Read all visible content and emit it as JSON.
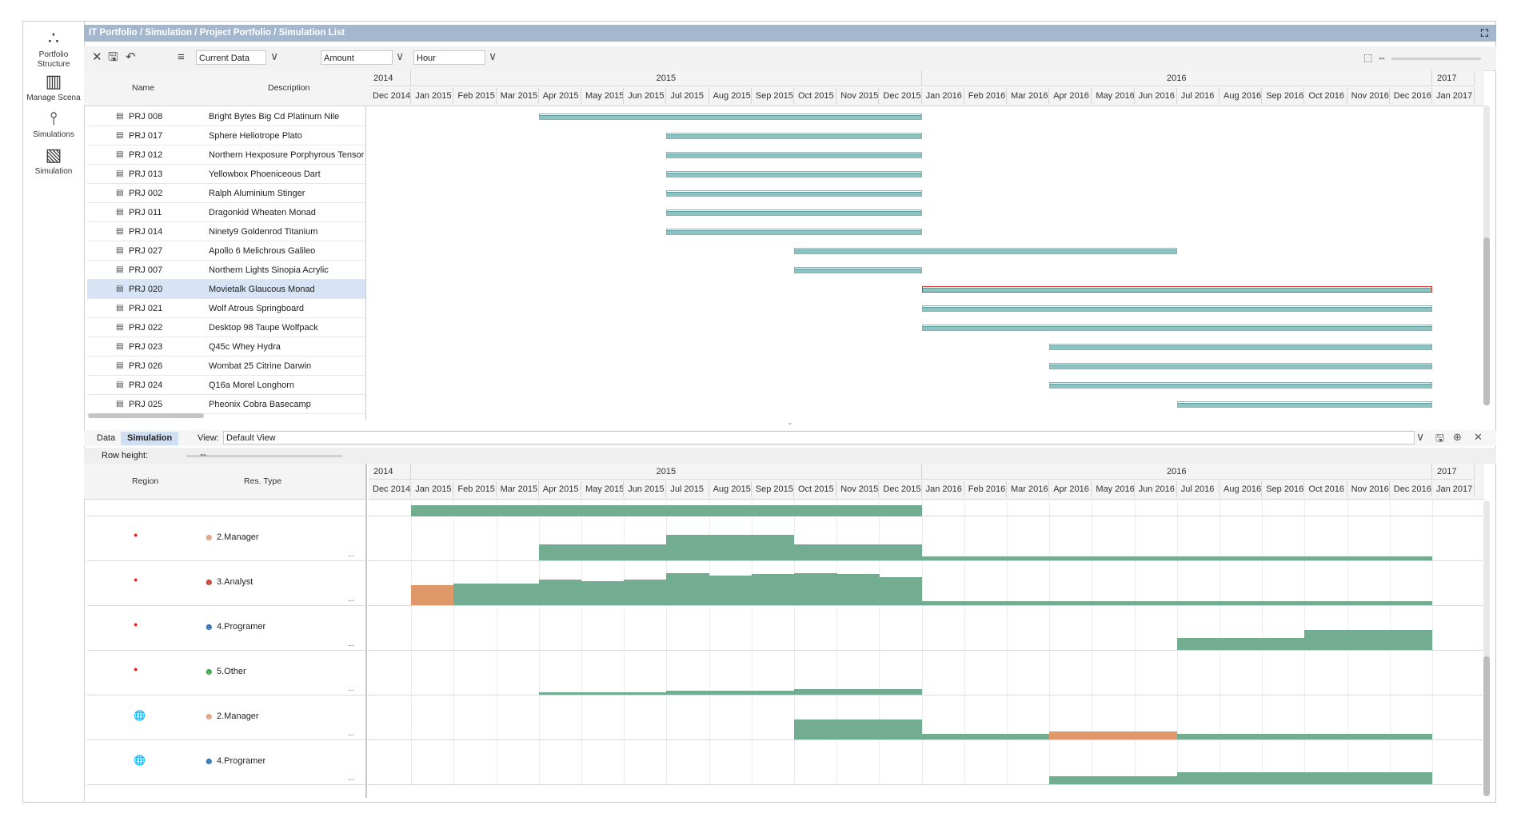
{
  "title": "IT Portfolio / Simulation / Project Portfolio / Simulation List",
  "nav": [
    {
      "label": "Portfolio Structure",
      "icon": "portfolio-structure-icon"
    },
    {
      "label": "Manage Scena",
      "icon": "manage-scenario-icon"
    },
    {
      "label": "Simulations",
      "icon": "simulations-icon"
    },
    {
      "label": "Simulation",
      "icon": "simulation-icon"
    }
  ],
  "toolbar": {
    "data_select": "Current Data",
    "amount_select": "Amount",
    "unit_select": "Hour"
  },
  "project_table": {
    "headers": {
      "name": "Name",
      "description": "Description"
    },
    "rows": [
      {
        "name": "PRJ 008",
        "description": "Bright Bytes Big Cd Platinum Nile",
        "start": 4,
        "end": 13,
        "selected": false
      },
      {
        "name": "PRJ 017",
        "description": "Sphere Heliotrope Plato",
        "start": 7,
        "end": 13,
        "selected": false
      },
      {
        "name": "PRJ 012",
        "description": "Northern Hexposure Porphyrous Tensor",
        "start": 7,
        "end": 13,
        "selected": false
      },
      {
        "name": "PRJ 013",
        "description": "Yellowbox Phoeniceous Dart",
        "start": 7,
        "end": 13,
        "selected": false
      },
      {
        "name": "PRJ 002",
        "description": "Ralph Aluminium Stinger",
        "start": 7,
        "end": 13,
        "selected": false
      },
      {
        "name": "PRJ 011",
        "description": "Dragonkid Wheaten Monad",
        "start": 7,
        "end": 13,
        "selected": false
      },
      {
        "name": "PRJ 014",
        "description": "Ninety9 Goldenrod Titanium",
        "start": 7,
        "end": 13,
        "selected": false
      },
      {
        "name": "PRJ 027",
        "description": "Apollo 6 Melichrous Galileo",
        "start": 10,
        "end": 19,
        "selected": false
      },
      {
        "name": "PRJ 007",
        "description": "Northern Lights Sinopia Acrylic",
        "start": 10,
        "end": 13,
        "selected": false
      },
      {
        "name": "PRJ 020",
        "description": "Movietalk Glaucous Monad",
        "start": 13,
        "end": 25,
        "selected": true
      },
      {
        "name": "PRJ 021",
        "description": "Wolf Atrous Springboard",
        "start": 13,
        "end": 25,
        "selected": false
      },
      {
        "name": "PRJ 022",
        "description": "Desktop 98 Taupe Wolfpack",
        "start": 13,
        "end": 25,
        "selected": false
      },
      {
        "name": "PRJ 023",
        "description": "Q45c Whey Hydra",
        "start": 16,
        "end": 25,
        "selected": false
      },
      {
        "name": "PRJ 026",
        "description": "Wombat 25 Citrine Darwin",
        "start": 16,
        "end": 25,
        "selected": false
      },
      {
        "name": "PRJ 024",
        "description": "Q16a Morel Longhorn",
        "start": 16,
        "end": 25,
        "selected": false
      },
      {
        "name": "PRJ 025",
        "description": "Pheonix Cobra Basecamp",
        "start": 19,
        "end": 25,
        "selected": false
      }
    ]
  },
  "timeline": {
    "years": [
      {
        "label": "2014",
        "months": 1
      },
      {
        "label": "2015",
        "months": 12
      },
      {
        "label": "2016",
        "months": 12
      },
      {
        "label": "2017",
        "months": 1
      }
    ],
    "months": [
      "Dec 2014",
      "Jan 2015",
      "Feb 2015",
      "Mar 2015",
      "Apr 2015",
      "May 2015",
      "Jun 2015",
      "Jul 2015",
      "Aug 2015",
      "Sep 2015",
      "Oct 2015",
      "Nov 2015",
      "Dec 2015",
      "Jan 2016",
      "Feb 2016",
      "Mar 2016",
      "Apr 2016",
      "May 2016",
      "Jun 2016",
      "Jul 2016",
      "Aug 2016",
      "Sep 2016",
      "Oct 2016",
      "Nov 2016",
      "Dec 2016",
      "Jan 2017"
    ]
  },
  "bottom": {
    "tabs": [
      "Data",
      "Simulation"
    ],
    "active_tab": "Simulation",
    "view_label": "View:",
    "view_value": "Default View",
    "row_height_label": "Row height:",
    "headers": {
      "region": "Region",
      "res_type": "Res. Type"
    },
    "dots": "...",
    "rows": [
      {
        "region_icon": "japan-flag-icon",
        "res_type": "2.Manager",
        "person_color": "#e0a080",
        "levels": [
          0,
          0,
          0,
          0,
          0.4,
          0.4,
          0.4,
          0.65,
          0.65,
          0.65,
          0.4,
          0.4,
          0.4,
          0.1,
          0.1,
          0.1,
          0.1,
          0.1,
          0.1,
          0.1,
          0.1,
          0.1,
          0.1,
          0.1,
          0.1,
          0
        ],
        "orange": []
      },
      {
        "region_icon": "japan-flag-icon",
        "res_type": "3.Analyst",
        "person_color": "#c0392b",
        "levels": [
          0,
          0.5,
          0.55,
          0.55,
          0.65,
          0.6,
          0.65,
          0.8,
          0.75,
          0.78,
          0.8,
          0.78,
          0.7,
          0.1,
          0.1,
          0.1,
          0.1,
          0.1,
          0.1,
          0.1,
          0.1,
          0.1,
          0.1,
          0.1,
          0.1,
          0
        ],
        "orange": [
          1
        ]
      },
      {
        "region_icon": "japan-flag-icon",
        "res_type": "4.Programer",
        "person_color": "#2c6fb7",
        "levels": [
          0,
          0,
          0,
          0,
          0,
          0,
          0,
          0,
          0,
          0,
          0,
          0,
          0,
          0,
          0,
          0,
          0,
          0,
          0,
          0.3,
          0.3,
          0.3,
          0.5,
          0.5,
          0.5,
          0
        ],
        "orange": []
      },
      {
        "region_icon": "japan-flag-icon",
        "res_type": "5.Other",
        "person_color": "#3aa34a",
        "levels": [
          0,
          0,
          0,
          0,
          0.06,
          0.06,
          0.06,
          0.1,
          0.1,
          0.1,
          0.14,
          0.14,
          0.14,
          0,
          0,
          0,
          0,
          0,
          0,
          0,
          0,
          0,
          0,
          0,
          0,
          0
        ],
        "orange": []
      },
      {
        "region_icon": "globe-icon",
        "res_type": "2.Manager",
        "person_color": "#e0a080",
        "levels": [
          0,
          0,
          0,
          0,
          0,
          0,
          0,
          0,
          0,
          0,
          0.5,
          0.5,
          0.5,
          0.14,
          0.14,
          0.14,
          0.2,
          0.2,
          0.2,
          0.14,
          0.14,
          0.14,
          0.14,
          0.14,
          0.14,
          0
        ],
        "orange": [
          16,
          17,
          18
        ]
      },
      {
        "region_icon": "globe-icon",
        "res_type": "4.Programer",
        "person_color": "#2c6fb7",
        "levels": [
          0,
          0,
          0,
          0,
          0,
          0,
          0,
          0,
          0,
          0,
          0,
          0,
          0,
          0,
          0,
          0,
          0.2,
          0.2,
          0.2,
          0.3,
          0.3,
          0.3,
          0.3,
          0.3,
          0.3,
          0
        ],
        "orange": []
      }
    ],
    "top_partial_levels": [
      0,
      0.25,
      0.25,
      0.25,
      0.25,
      0.25,
      0.25,
      0.25,
      0.25,
      0.25,
      0.25,
      0.25,
      0.25,
      0,
      0,
      0,
      0,
      0,
      0,
      0,
      0,
      0,
      0,
      0,
      0,
      0
    ]
  }
}
